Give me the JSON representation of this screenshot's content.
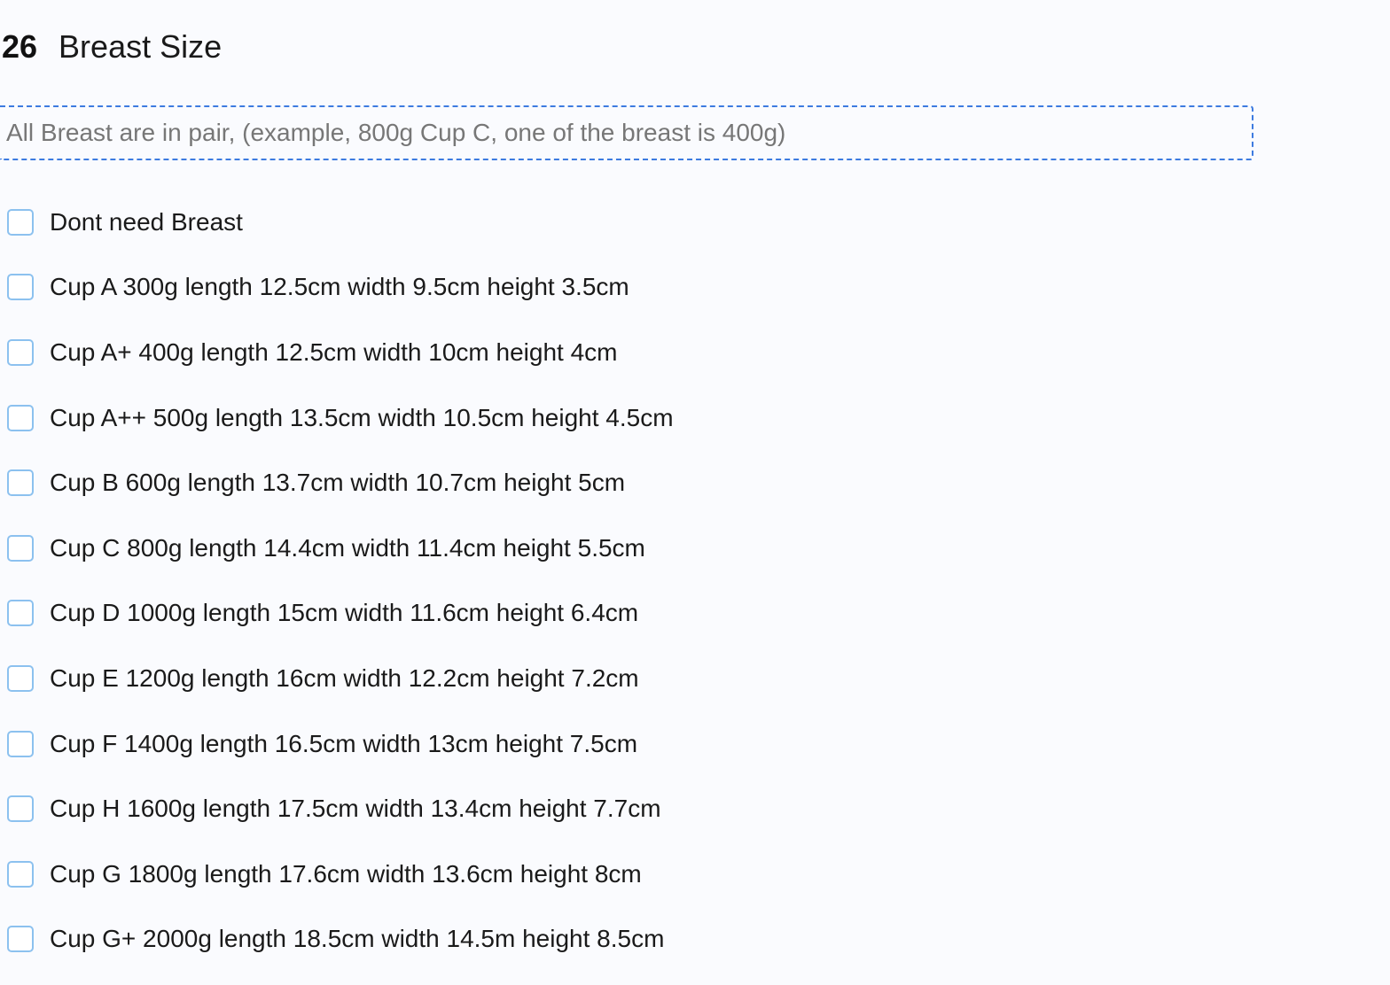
{
  "question": {
    "number": "26",
    "title": "Breast Size",
    "note": "All Breast are in pair, (example, 800g Cup C, one of the breast is 400g)",
    "options": [
      {
        "label": "Dont need Breast",
        "checked": false
      },
      {
        "label": "Cup A 300g length 12.5cm width 9.5cm height 3.5cm",
        "checked": false
      },
      {
        "label": "Cup A+ 400g length 12.5cm width 10cm height 4cm",
        "checked": false
      },
      {
        "label": "Cup A++ 500g length 13.5cm width 10.5cm height 4.5cm",
        "checked": false
      },
      {
        "label": "Cup B 600g length 13.7cm width 10.7cm height 5cm",
        "checked": false
      },
      {
        "label": "Cup C 800g length 14.4cm width 11.4cm height 5.5cm",
        "checked": false
      },
      {
        "label": "Cup D 1000g length 15cm width 11.6cm height 6.4cm",
        "checked": false
      },
      {
        "label": "Cup E 1200g length 16cm width 12.2cm height 7.2cm",
        "checked": false
      },
      {
        "label": "Cup F 1400g length 16.5cm width 13cm height 7.5cm",
        "checked": false
      },
      {
        "label": "Cup H 1600g length 17.5cm width 13.4cm height 7.7cm",
        "checked": false
      },
      {
        "label": "Cup G 1800g length 17.6cm width 13.6cm height 8cm",
        "checked": false
      },
      {
        "label": "Cup G+ 2000g length 18.5cm width 14.5m height 8.5cm",
        "checked": false
      }
    ]
  },
  "colors": {
    "accent": "#3d7be0",
    "checkbox_border": "#8cc1ef",
    "note_text": "#777777",
    "background": "#fafbfe"
  }
}
